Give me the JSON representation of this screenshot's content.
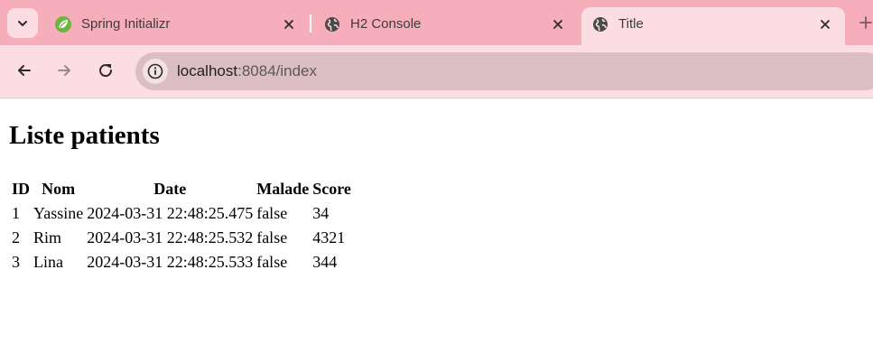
{
  "browser": {
    "tabs": [
      {
        "title": "Spring Initializr",
        "icon": "spring-leaf-icon"
      },
      {
        "title": "H2 Console",
        "icon": "globe-icon"
      },
      {
        "title": "Title",
        "icon": "globe-icon",
        "active": true
      }
    ],
    "address": {
      "host": "localhost",
      "path": ":8084/index"
    },
    "colors": {
      "tabstrip": "#f7aebb",
      "toolbar": "#fddde4",
      "omnibox": "#dbbec3"
    }
  },
  "page": {
    "heading": "Liste patients",
    "table": {
      "headers": [
        "ID",
        "Nom",
        "Date",
        "Malade",
        "Score"
      ],
      "rows": [
        [
          "1",
          "Yassine",
          "2024-03-31 22:48:25.475",
          "false",
          "34"
        ],
        [
          "2",
          "Rim",
          "2024-03-31 22:48:25.532",
          "false",
          "4321"
        ],
        [
          "3",
          "Lina",
          "2024-03-31 22:48:25.533",
          "false",
          "344"
        ]
      ]
    }
  }
}
